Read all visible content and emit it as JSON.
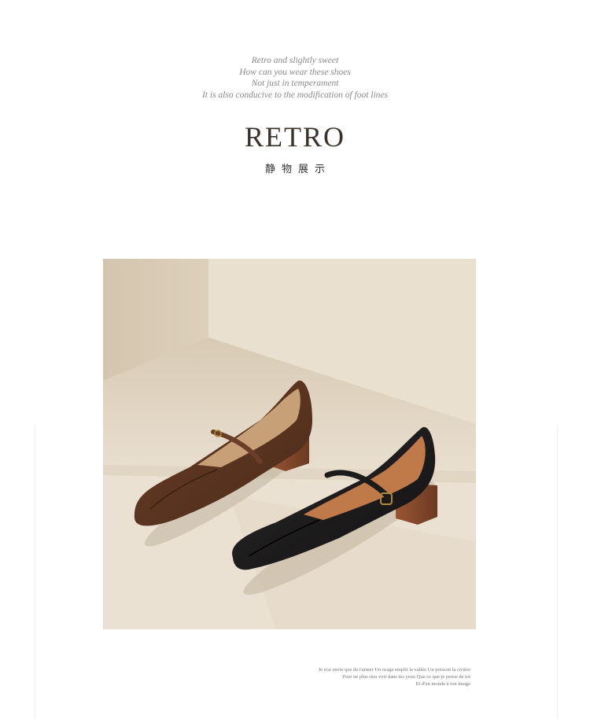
{
  "intro_lines": [
    "Retro and slightly sweet",
    "How can you wear these shoes",
    "Not just in temperament",
    "It is also conducive to the modification of foot lines"
  ],
  "title": "RETRO",
  "subtitle": "静物展示",
  "photo": {
    "subject": "brown and black square-toe mary jane shoes with buckle straps on a beige step",
    "colors": {
      "wall": "#e6dccb",
      "floor": "#d9ccb7",
      "brown_shoe": "#5a3421",
      "black_shoe": "#1c1b1c",
      "heel_wood": "#8a4b2d"
    }
  },
  "caption_lines": [
    "Je n'ai envie que de t'aimer Un orage emplit la vallée Un poisson la rivière",
    "Pour ne plus rien voir dans tes yeux Que ce que je pense de toi",
    "Et d'un monde à ton image"
  ]
}
